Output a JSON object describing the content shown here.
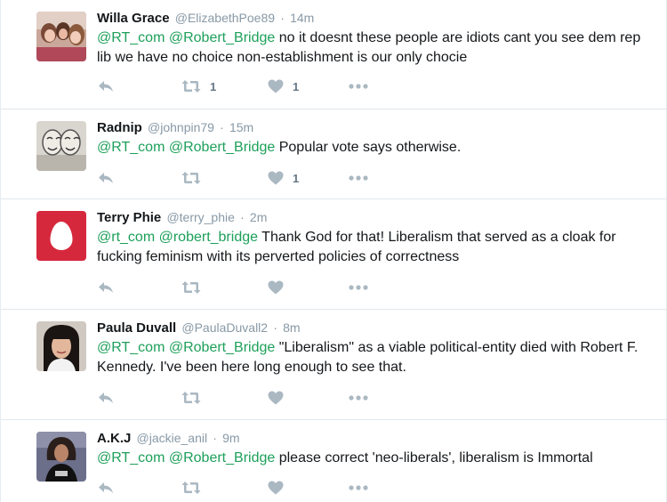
{
  "tweets": [
    {
      "name": "Willa Grace",
      "handle": "@ElizabethPoe89",
      "time": "14m",
      "mentions": [
        "@RT_com",
        "@Robert_Bridge"
      ],
      "text": " no it doesnt these people are idiots cant you see dem rep lib we have no choice non-establishment is our only chocie",
      "retweet_count": "1",
      "like_count": "1",
      "avatar": "photo-three-women"
    },
    {
      "name": "Radnip",
      "handle": "@johnpin79",
      "time": "15m",
      "mentions": [
        "@RT_com",
        "@Robert_Bridge"
      ],
      "text": " Popular vote says otherwise.",
      "retweet_count": "",
      "like_count": "1",
      "avatar": "sketch-masks"
    },
    {
      "name": "Terry Phie",
      "handle": "@terry_phie",
      "time": "2m",
      "mentions": [
        "@rt_com",
        "@robert_bridge"
      ],
      "text": " Thank God for that! Liberalism that served as a cloak for fucking feminism with its perverted policies of correctness",
      "retweet_count": "",
      "like_count": "",
      "avatar": "default-egg"
    },
    {
      "name": "Paula Duvall",
      "handle": "@PaulaDuvall2",
      "time": "8m",
      "mentions": [
        "@RT_com",
        "@Robert_Bridge"
      ],
      "text": " \"Liberalism\" as a viable political-entity died with Robert F. Kennedy. I've been here long enough to see that.",
      "retweet_count": "",
      "like_count": "",
      "avatar": "photo-woman-dark-hair"
    },
    {
      "name": "A.K.J",
      "handle": "@jackie_anil",
      "time": "9m",
      "mentions": [
        "@RT_com",
        "@Robert_Bridge"
      ],
      "text": " please correct 'neo-liberals', liberalism is Immortal",
      "retweet_count": "",
      "like_count": "",
      "avatar": "photo-rock-tshirt"
    }
  ],
  "separator": "·",
  "colors": {
    "mention": "#1da05a",
    "meta": "#8899a6",
    "icon": "#aab8c2",
    "egg_bg": "#d6283d"
  }
}
